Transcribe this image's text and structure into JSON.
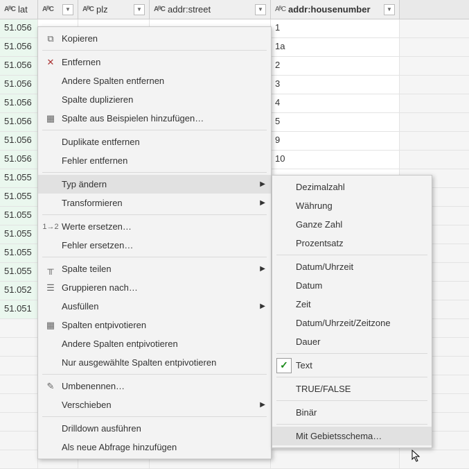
{
  "columns": [
    {
      "name": "lat",
      "type_icon": "AᴮC"
    },
    {
      "name": "",
      "type_icon": "AᴮC"
    },
    {
      "name": "plz",
      "type_icon": "AᴮC"
    },
    {
      "name": "addr:street",
      "type_icon": "AᴮC"
    },
    {
      "name": "addr:housenumber",
      "type_icon": "AᴮC"
    }
  ],
  "rows": [
    {
      "lat": "51.056",
      "hn": "1"
    },
    {
      "lat": "51.056",
      "hn": "1a"
    },
    {
      "lat": "51.056",
      "hn": "2"
    },
    {
      "lat": "51.056",
      "hn": "3"
    },
    {
      "lat": "51.056",
      "hn": "4"
    },
    {
      "lat": "51.056",
      "hn": "5"
    },
    {
      "lat": "51.056",
      "hn": "9"
    },
    {
      "lat": "51.056",
      "hn": "10"
    },
    {
      "lat": "51.055",
      "hn": ""
    },
    {
      "lat": "51.055",
      "hn": ""
    },
    {
      "lat": "51.055",
      "hn": ""
    },
    {
      "lat": "51.055",
      "hn": ""
    },
    {
      "lat": "51.055",
      "hn": ""
    },
    {
      "lat": "51.055",
      "hn": ""
    },
    {
      "lat": "51.052",
      "hn": ""
    },
    {
      "lat": "51.051",
      "hn": ""
    }
  ],
  "menu": {
    "copy": "Kopieren",
    "remove": "Entfernen",
    "remove_others": "Andere Spalten entfernen",
    "duplicate": "Spalte duplizieren",
    "add_from_examples": "Spalte aus Beispielen hinzufügen…",
    "remove_dupes": "Duplikate entfernen",
    "remove_errors": "Fehler entfernen",
    "change_type": "Typ ändern",
    "transform": "Transformieren",
    "replace_values": "Werte ersetzen…",
    "replace_errors": "Fehler ersetzen…",
    "split_column": "Spalte teilen",
    "group_by": "Gruppieren nach…",
    "fill": "Ausfüllen",
    "unpivot": "Spalten entpivotieren",
    "unpivot_others": "Andere Spalten entpivotieren",
    "unpivot_selected": "Nur ausgewählte Spalten entpivotieren",
    "rename": "Umbenennen…",
    "move": "Verschieben",
    "drilldown": "Drilldown ausführen",
    "add_as_query": "Als neue Abfrage hinzufügen"
  },
  "submenu": {
    "decimal": "Dezimalzahl",
    "currency": "Währung",
    "whole_number": "Ganze Zahl",
    "percentage": "Prozentsatz",
    "datetime": "Datum/Uhrzeit",
    "date": "Datum",
    "time": "Zeit",
    "dtz": "Datum/Uhrzeit/Zeitzone",
    "duration": "Dauer",
    "text": "Text",
    "truefalse": "TRUE/FALSE",
    "binary": "Binär",
    "with_locale": "Mit Gebietsschema…"
  }
}
